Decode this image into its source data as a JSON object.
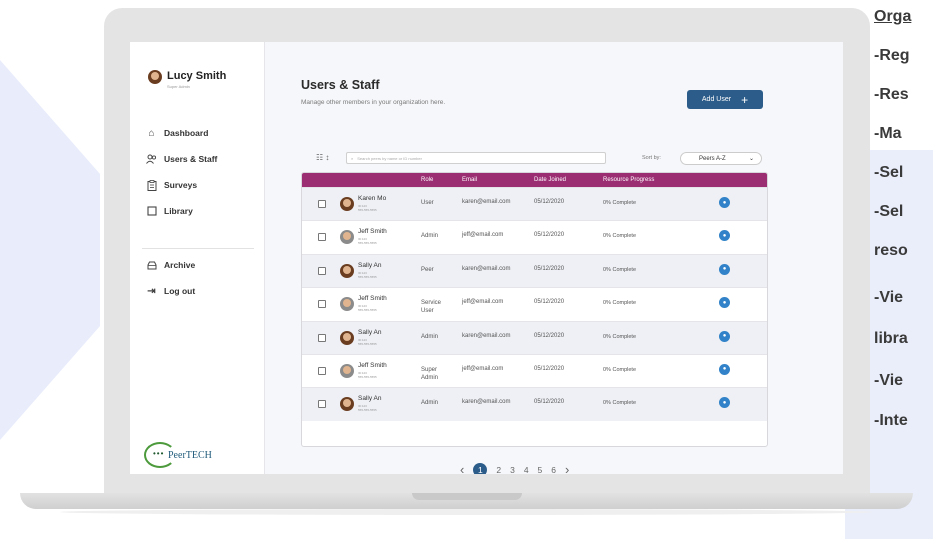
{
  "profile": {
    "name": "Lucy Smith",
    "role": "Super Admin"
  },
  "nav": [
    {
      "label": "Dashboard",
      "icon": "home-icon"
    },
    {
      "label": "Users & Staff",
      "icon": "users-icon"
    },
    {
      "label": "Surveys",
      "icon": "clipboard-icon"
    },
    {
      "label": "Library",
      "icon": "book-icon"
    }
  ],
  "nav_bottom": [
    {
      "label": "Archive",
      "icon": "archive-icon"
    },
    {
      "label": "Log out",
      "icon": "logout-icon"
    }
  ],
  "logo": {
    "text": "PeerTECH"
  },
  "main": {
    "title": "Users & Staff",
    "subtitle": "Manage other members in your organization here.",
    "add_button": "Add User"
  },
  "toolbar": {
    "filter_label": "☷ ↕",
    "search_placeholder": "Search peers by name or ID number",
    "sort_label": "Sort by:",
    "sort_value": "Peers A-Z"
  },
  "table": {
    "columns": [
      "Role",
      "Email",
      "Date Joined",
      "Resource Progress"
    ],
    "rows": [
      {
        "name": "Karen Mo",
        "id": "ID:123",
        "phone": "555-555-5555",
        "role": "User",
        "email": "karen@email.com",
        "date": "05/12/2020",
        "progress": "0% Complete",
        "avatar": "brown"
      },
      {
        "name": "Jeff Smith",
        "id": "ID:123",
        "phone": "555-555-5555",
        "role": "Admin",
        "email": "jeff@email.com",
        "date": "05/12/2020",
        "progress": "0% Complete",
        "avatar": "gray"
      },
      {
        "name": "Sally An",
        "id": "ID:123",
        "phone": "555-555-5555",
        "role": "Peer",
        "email": "karen@email.com",
        "date": "05/12/2020",
        "progress": "0% Complete",
        "avatar": "brown"
      },
      {
        "name": "Jeff Smith",
        "id": "ID:123",
        "phone": "555-555-5555",
        "role": "Service User",
        "email": "jeff@email.com",
        "date": "05/12/2020",
        "progress": "0% Complete",
        "avatar": "gray"
      },
      {
        "name": "Sally An",
        "id": "ID:123",
        "phone": "555-555-5555",
        "role": "Admin",
        "email": "karen@email.com",
        "date": "05/12/2020",
        "progress": "0% Complete",
        "avatar": "brown"
      },
      {
        "name": "Jeff Smith",
        "id": "ID:123",
        "phone": "555-555-5555",
        "role": "Super Admin",
        "email": "jeff@email.com",
        "date": "05/12/2020",
        "progress": "0% Complete",
        "avatar": "gray"
      },
      {
        "name": "Sally An",
        "id": "ID:123",
        "phone": "555-555-5555",
        "role": "Admin",
        "email": "karen@email.com",
        "date": "05/12/2020",
        "progress": "0% Complete",
        "avatar": "brown"
      }
    ]
  },
  "pagination": {
    "prev": "‹",
    "pages": [
      "1",
      "2",
      "3",
      "4",
      "5",
      "6"
    ],
    "next": "›",
    "active": "1"
  },
  "side_text": {
    "heading": "Orga",
    "lines": [
      "-Reg",
      "-Res",
      "-Ma",
      "-Sel",
      "-Sel",
      "reso",
      "-Vie",
      "libra",
      "-Vie",
      "-Inte"
    ]
  },
  "colors": {
    "table_header": "#9b2e73",
    "primary": "#2c5c8a",
    "action": "#3182c8"
  }
}
